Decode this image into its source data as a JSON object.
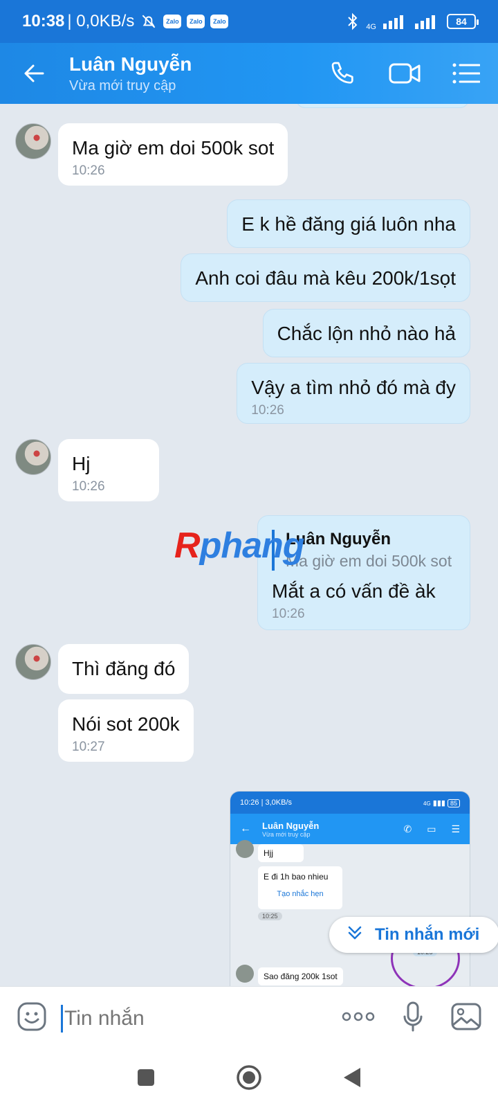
{
  "status_bar": {
    "time": "10:38",
    "network_speed": "| 0,0KB/s",
    "zalo_badge": "Zalo",
    "network_type": "4G",
    "battery": "84"
  },
  "header": {
    "contact_name": "Luân Nguyễn",
    "contact_status": "Vừa mới truy cập"
  },
  "messages": [
    {
      "dir": "in",
      "text": "Ma giờ em doi 500k sot",
      "time": "10:26"
    },
    {
      "dir": "out",
      "text": "E k hề đăng giá luôn nha"
    },
    {
      "dir": "out",
      "text": "Anh coi đâu mà kêu 200k/1sọt"
    },
    {
      "dir": "out",
      "text": "Chắc lộn nhỏ nào hả"
    },
    {
      "dir": "out",
      "text": "Vậy a tìm nhỏ đó mà đy",
      "time": "10:26"
    },
    {
      "dir": "in",
      "text": "Hj",
      "time": "10:26"
    },
    {
      "dir": "out",
      "reply_name": "Luân Nguyễn",
      "reply_text": "Ma giờ em doi 500k sot",
      "text": "Mắt a có vấn đề àk",
      "time": "10:26"
    },
    {
      "dir": "in",
      "text": "Thì đăng đó"
    },
    {
      "dir": "in",
      "text": "Nói sot 200k",
      "time": "10:27"
    }
  ],
  "watermark": {
    "part1": "R",
    "part2": "phang"
  },
  "embedded_screenshot": {
    "time": "10:26 | 3,0KB/s",
    "network": "4G",
    "battery": "85",
    "contact_name": "Luân Nguyễn",
    "contact_status": "Vừa mới truy cập",
    "msg1": "Hjj",
    "msg2": "E đi 1h bao nhieu",
    "reminder": "Tạo nhắc hẹn",
    "pill_time": "10:25",
    "pill_time2": "10:25",
    "msg3": "Sao đăng 200k 1sot"
  },
  "new_message_button": "Tin nhắn mới",
  "input": {
    "placeholder": "Tin nhắn"
  },
  "icons": [
    "back-arrow-icon",
    "phone-icon",
    "video-call-icon",
    "menu-icon",
    "sticker-icon",
    "more-icon",
    "microphone-icon",
    "image-icon",
    "chevron-down-double-icon"
  ],
  "colors": {
    "brand": "#1a76d8",
    "outgoing_bubble": "#d5edfb",
    "incoming_bubble": "#ffffff",
    "chat_bg": "#e2e8ef"
  }
}
